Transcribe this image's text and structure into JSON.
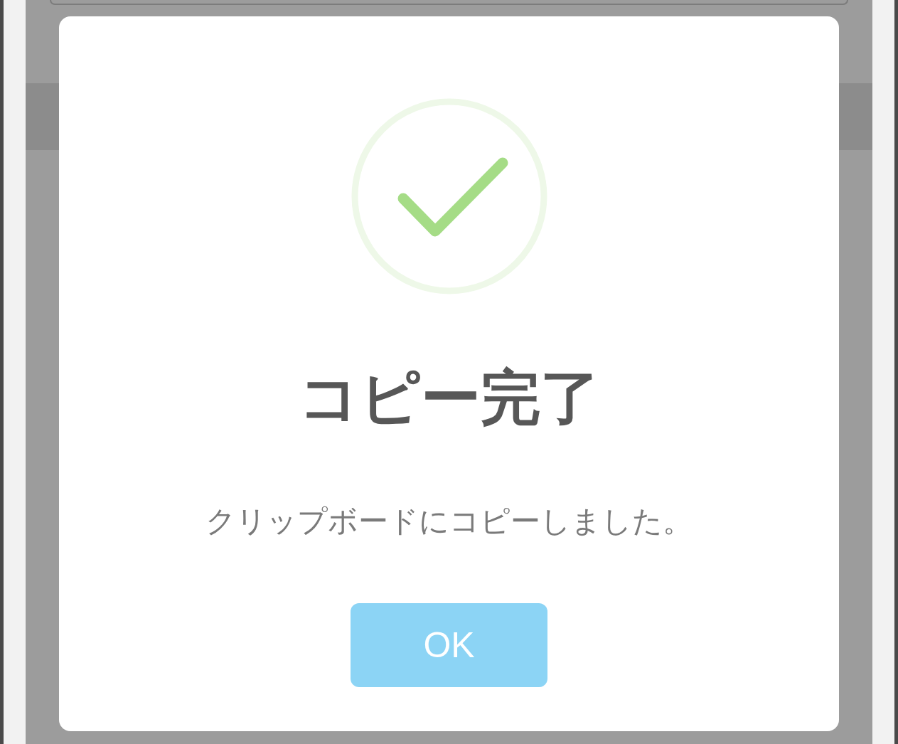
{
  "dialog": {
    "kind": "success",
    "title": "コピー完了",
    "message": "クリップボードにコピーしました。",
    "button": "OK"
  }
}
